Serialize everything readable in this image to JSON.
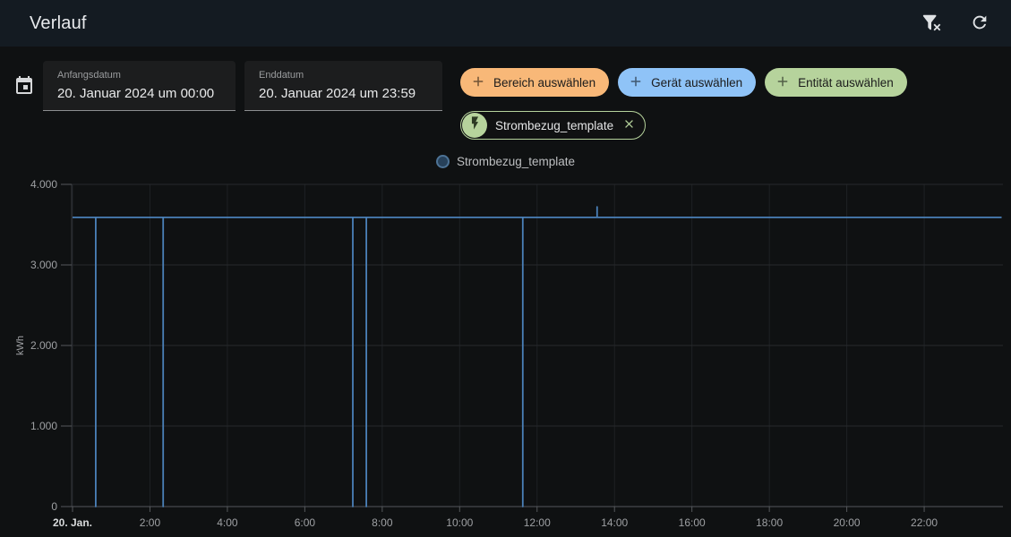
{
  "header": {
    "title": "Verlauf"
  },
  "toolbar": {
    "start_date": {
      "label": "Anfangsdatum",
      "value": "20. Januar 2024 um 00:00"
    },
    "end_date": {
      "label": "Enddatum",
      "value": "20. Januar 2024 um 23:59"
    },
    "chips": [
      {
        "label": "Bereich auswählen",
        "color": "#f8b878"
      },
      {
        "label": "Gerät auswählen",
        "color": "#8fc3f7"
      },
      {
        "label": "Entität auswählen",
        "color": "#b6d39c"
      }
    ],
    "selected_entity": {
      "label": "Strombezug_template",
      "color": "#b6d39c"
    }
  },
  "legend": {
    "items": [
      {
        "label": "Strombezug_template",
        "marker_fill": "#27415a",
        "marker_border": "#4d7396"
      }
    ]
  },
  "chart_data": {
    "type": "line",
    "title": "",
    "ylabel": "kWh",
    "ylim": [
      0,
      4000
    ],
    "grid": true,
    "legend_position": "top-center",
    "yticks": [
      {
        "value": 0,
        "label": "0"
      },
      {
        "value": 1000,
        "label": "1.000"
      },
      {
        "value": 2000,
        "label": "2.000"
      },
      {
        "value": 3000,
        "label": "3.000"
      },
      {
        "value": 4000,
        "label": "4.000"
      }
    ],
    "xticks": [
      {
        "hour": 0,
        "label": "20. Jan.",
        "bold": true
      },
      {
        "hour": 2,
        "label": "2:00"
      },
      {
        "hour": 4,
        "label": "4:00"
      },
      {
        "hour": 6,
        "label": "6:00"
      },
      {
        "hour": 8,
        "label": "8:00"
      },
      {
        "hour": 10,
        "label": "10:00"
      },
      {
        "hour": 12,
        "label": "12:00"
      },
      {
        "hour": 14,
        "label": "14:00"
      },
      {
        "hour": 16,
        "label": "16:00"
      },
      {
        "hour": 18,
        "label": "18:00"
      },
      {
        "hour": 20,
        "label": "20:00"
      },
      {
        "hour": 22,
        "label": "22:00"
      }
    ],
    "x_range_hours": [
      0,
      24
    ],
    "series": [
      {
        "name": "Strombezug_template",
        "color": "#4a80b8",
        "unit": "kWh",
        "baseline_value": 3590,
        "dropouts_to_zero_at_hours": [
          0.6,
          2.34,
          7.24,
          7.59,
          11.63
        ],
        "spike": {
          "hour": 13.55,
          "value": 3720
        },
        "points": [
          [
            0,
            3590
          ],
          [
            0.6,
            3590
          ],
          [
            0.6,
            0
          ],
          [
            0.6,
            3590
          ],
          [
            2.34,
            3590
          ],
          [
            2.34,
            0
          ],
          [
            2.34,
            3590
          ],
          [
            7.24,
            3590
          ],
          [
            7.24,
            0
          ],
          [
            7.24,
            3590
          ],
          [
            7.59,
            3590
          ],
          [
            7.59,
            0
          ],
          [
            7.59,
            3590
          ],
          [
            11.63,
            3590
          ],
          [
            11.63,
            0
          ],
          [
            11.63,
            3590
          ],
          [
            13.55,
            3590
          ],
          [
            13.55,
            3720
          ],
          [
            13.55,
            3590
          ],
          [
            24,
            3590
          ]
        ]
      }
    ]
  }
}
